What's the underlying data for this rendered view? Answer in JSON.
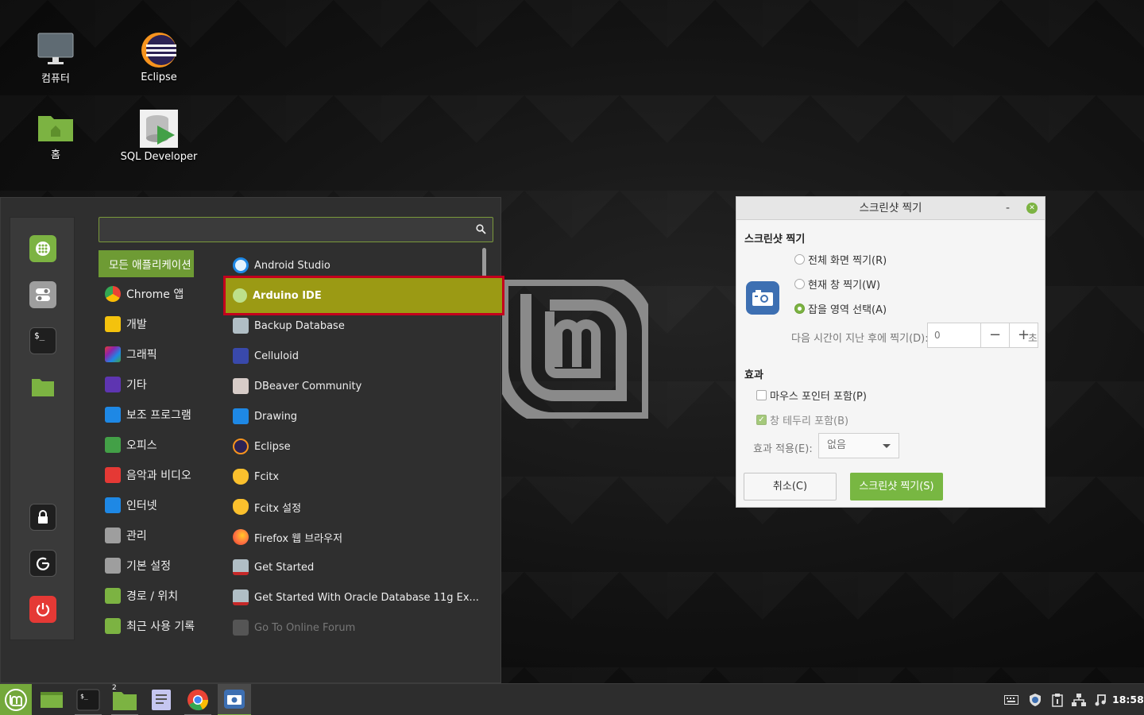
{
  "desktop": {
    "icons": [
      {
        "label": "컴퓨터"
      },
      {
        "label": "Eclipse"
      },
      {
        "label": "홈"
      },
      {
        "label": "SQL Developer"
      }
    ]
  },
  "menu": {
    "search": {
      "value": "",
      "placeholder": ""
    },
    "categories": [
      {
        "label": "모든 애플리케이션",
        "color": "#6e9b34"
      },
      {
        "label": "Chrome 앱",
        "color": "#e53935"
      },
      {
        "label": "개발",
        "color": "#f4c20d"
      },
      {
        "label": "그래픽",
        "color": "#d81b60"
      },
      {
        "label": "기타",
        "color": "#5e35b1"
      },
      {
        "label": "보조 프로그램",
        "color": "#1e88e5"
      },
      {
        "label": "오피스",
        "color": "#43a047"
      },
      {
        "label": "음악과 비디오",
        "color": "#e53935"
      },
      {
        "label": "인터넷",
        "color": "#1e88e5"
      },
      {
        "label": "관리",
        "color": "#757575"
      },
      {
        "label": "기본 설정",
        "color": "#757575"
      },
      {
        "label": "경로 / 위치",
        "color": "#7cb342"
      },
      {
        "label": "최근 사용 기록",
        "color": "#7cb342"
      }
    ],
    "apps": [
      {
        "label": "Android Studio",
        "color": "#1e88e5"
      },
      {
        "label": "Arduino IDE",
        "color": "#00979d"
      },
      {
        "label": "Backup Database",
        "color": "#9e9e9e"
      },
      {
        "label": "Celluloid",
        "color": "#3949ab"
      },
      {
        "label": "DBeaver Community",
        "color": "#8d6e63"
      },
      {
        "label": "Drawing",
        "color": "#1e88e5"
      },
      {
        "label": "Eclipse",
        "color": "#2c2255"
      },
      {
        "label": "Fcitx",
        "color": "#fbc02d"
      },
      {
        "label": "Fcitx 설정",
        "color": "#fbc02d"
      },
      {
        "label": "Firefox 웹 브라우저",
        "color": "#ff7043"
      },
      {
        "label": "Get Started",
        "color": "#c62828"
      },
      {
        "label": "Get Started With Oracle Database 11g Ex...",
        "color": "#c62828"
      },
      {
        "label": "Go To Online Forum",
        "color": "#616161"
      }
    ]
  },
  "dialog": {
    "title": "스크린샷 찍기",
    "section_capture": "스크린샷 찍기",
    "opt_fullscreen": "전체 화면 찍기(R)",
    "opt_window": "현재 창 찍기(W)",
    "opt_area": "잡을 영역 선택(A)",
    "selected_option": "잡을 영역 선택(A)",
    "delay_label": "다음 시간이 지난 후에 찍기(D):",
    "delay_value": "0",
    "minus": "−",
    "plus": "+",
    "delay_unit": "초",
    "section_effects": "효과",
    "include_pointer": "마우스 포인터 포함(P)",
    "include_pointer_checked": false,
    "include_border": "창 테두리 포함(B)",
    "include_border_checked": true,
    "apply_effect_label": "효과 적용(E):",
    "apply_effect_value": "없음",
    "cancel": "취소(C)",
    "take": "스크린샷 찍기(S)"
  },
  "taskbar": {
    "workspace_badge": "2",
    "clock": "18:58"
  },
  "colors": {
    "mint_green": "#7cb342",
    "highlight_border": "#c4001d",
    "highlight_fill": "#9b9a14"
  }
}
